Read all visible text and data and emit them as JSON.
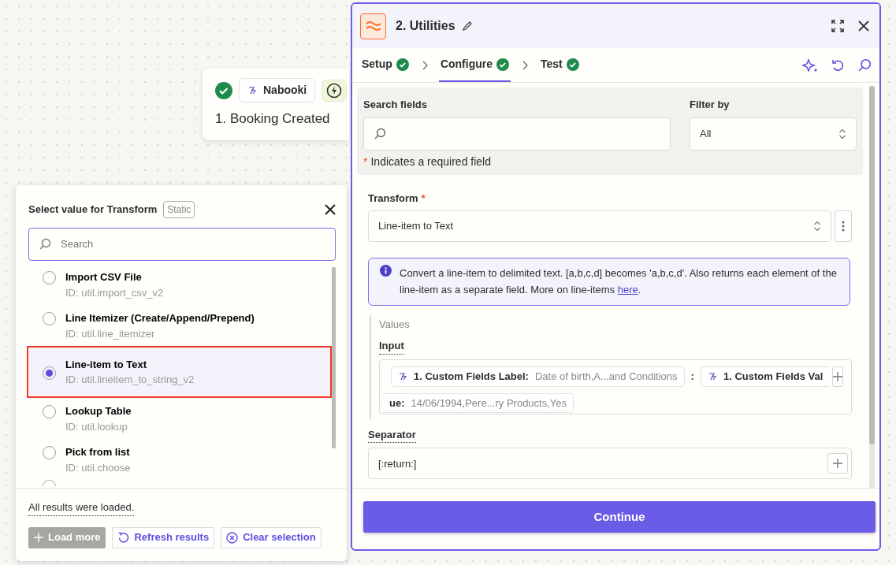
{
  "trigger_card": {
    "status_ok": true,
    "app": "Nabooki",
    "title": "1. Booking Created"
  },
  "panel": {
    "title": "2. Utilities",
    "tabs": [
      {
        "label": "Setup",
        "complete": true,
        "selected": false
      },
      {
        "label": "Configure",
        "complete": true,
        "selected": true
      },
      {
        "label": "Test",
        "complete": true,
        "selected": false
      }
    ],
    "search_fields": {
      "label": "Search fields"
    },
    "filter_by": {
      "label": "Filter by",
      "value": "All"
    },
    "required_note": {
      "mark": "*",
      "text": "Indicates a required field"
    },
    "transform": {
      "label": "Transform",
      "required_mark": "*",
      "value": "Line-item to Text"
    },
    "info": {
      "text": "Convert a line-item to delimited text. [a,b,c,d] becomes 'a,b,c,d'. Also returns each element of the line-item as a separate field. More on line-items ",
      "link": "here",
      "after": "."
    },
    "values_label": "Values",
    "input": {
      "label": "Input",
      "token_1": {
        "label": "1. Custom Fields Label:",
        "value": "Date of birth,A...and Conditions"
      },
      "joiner": ":",
      "token_2": {
        "label_start": "1. Custom Fields Val",
        "label_end": "ue:",
        "value": "14/06/1994,Pere...ry Products,Yes"
      }
    },
    "separator": {
      "label": "Separator",
      "value": "[:return:]"
    },
    "continue": "Continue"
  },
  "popup": {
    "title": "Select value for Transform",
    "badge": "Static",
    "search_placeholder": "Search",
    "options": [
      {
        "name": "Import CSV File",
        "id": "ID: util.import_csv_v2",
        "selected": false
      },
      {
        "name": "Line Itemizer (Create/Append/Prepend)",
        "id": "ID: util.line_itemizer",
        "selected": false
      },
      {
        "name": "Line-item to Text",
        "id": "ID: util.lineitem_to_string_v2",
        "selected": true
      },
      {
        "name": "Lookup Table",
        "id": "ID: util.lookup",
        "selected": false
      },
      {
        "name": "Pick from list",
        "id": "ID: util.choose",
        "selected": false
      }
    ],
    "status": "All results were loaded.",
    "buttons": [
      {
        "label": "Load more",
        "kind": "plus",
        "disabled": true
      },
      {
        "label": "Refresh results",
        "kind": "refresh",
        "disabled": false
      },
      {
        "label": "Clear selection",
        "kind": "clear",
        "disabled": false
      }
    ]
  }
}
